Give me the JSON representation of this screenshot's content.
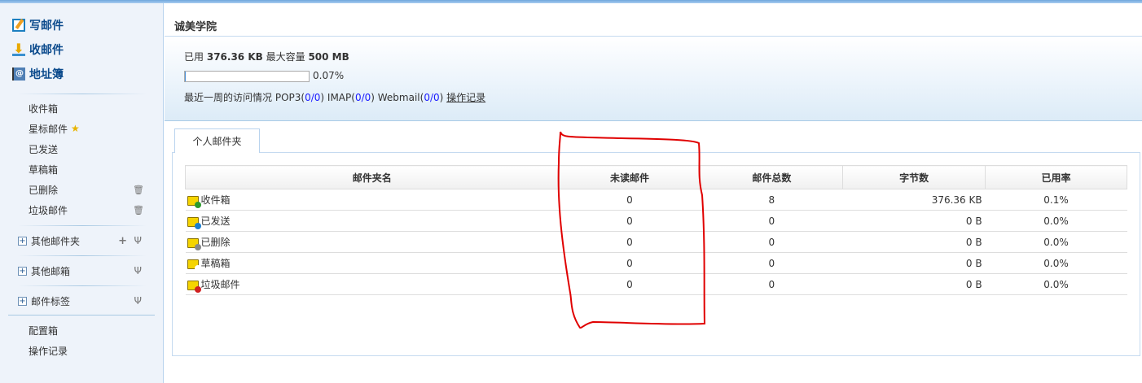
{
  "sidebar": {
    "compose": "写邮件",
    "receive": "收邮件",
    "contacts": "地址簿",
    "folders": [
      {
        "label": "收件箱"
      },
      {
        "label": "星标邮件"
      },
      {
        "label": "已发送"
      },
      {
        "label": "草稿箱"
      },
      {
        "label": "已删除"
      },
      {
        "label": "垃圾邮件"
      }
    ],
    "groups": [
      {
        "label": "其他邮件夹"
      },
      {
        "label": "其他邮箱"
      },
      {
        "label": "邮件标签"
      }
    ],
    "bottom": [
      {
        "label": "配置箱"
      },
      {
        "label": "操作记录"
      }
    ]
  },
  "main": {
    "title": "诚美学院",
    "used_label": "已用",
    "used": "376.36 KB",
    "max_label": "最大容量",
    "max": "500 MB",
    "usage_pct": "0.07%",
    "usage_fraction": 0.0007,
    "access_label": "最近一周的访问情况",
    "pop3_label": "POP3",
    "pop3": "0/0",
    "imap_label": "IMAP",
    "imap": "0/0",
    "webmail_label": "Webmail",
    "webmail": "0/0",
    "log_link": "操作记录",
    "tab": "个人邮件夹",
    "columns": [
      "邮件夹名",
      "未读邮件",
      "邮件总数",
      "字节数",
      "已用率"
    ],
    "rows": [
      {
        "name": "收件箱",
        "unread": "0",
        "total": "8",
        "bytes": "376.36 KB",
        "usage": "0.1%"
      },
      {
        "name": "已发送",
        "unread": "0",
        "total": "0",
        "bytes": "0 B",
        "usage": "0.0%"
      },
      {
        "name": "已删除",
        "unread": "0",
        "total": "0",
        "bytes": "0 B",
        "usage": "0.0%"
      },
      {
        "name": "草稿箱",
        "unread": "0",
        "total": "0",
        "bytes": "0 B",
        "usage": "0.0%"
      },
      {
        "name": "垃圾邮件",
        "unread": "0",
        "total": "0",
        "bytes": "0 B",
        "usage": "0.0%"
      }
    ]
  },
  "colors": {
    "annotation": "#e00000",
    "link": "#1a1aff",
    "title": "#0b4a8c"
  }
}
